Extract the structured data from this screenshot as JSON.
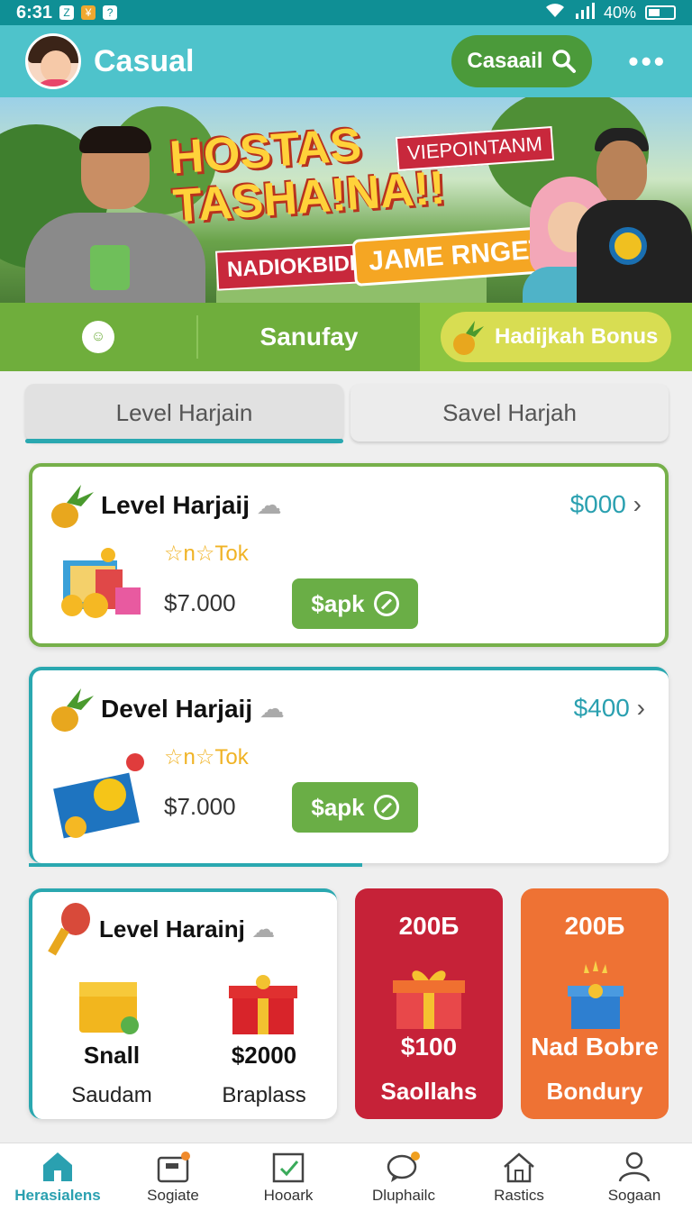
{
  "status_bar": {
    "time": "6:31",
    "battery": "40%"
  },
  "header": {
    "title": "Casual",
    "search_label": "Casaail",
    "more": "•••"
  },
  "banner": {
    "headline_line1": "HOSTAS",
    "headline_line2": "TASHA!NA!!",
    "tag": "VIEPOINTANM",
    "pill_red": "NADIOKBIDM",
    "pill_yellow": "JAME RNGET"
  },
  "greenbar": {
    "tab_label": "Sanufay",
    "bonus_label": "Hadijkah Bonus"
  },
  "tabs": [
    {
      "label": "Level Harjain"
    },
    {
      "label": "Savel Harjah"
    }
  ],
  "cards": [
    {
      "title": "Level Harjaij",
      "price": "$000",
      "stars": "☆n☆Tok",
      "amount": "$7.000",
      "button": "$apk"
    },
    {
      "title": "Devel Harjaij",
      "price": "$400",
      "stars": "☆n☆Tok",
      "amount": "$7.000",
      "button": "$apk"
    }
  ],
  "small_card": {
    "title": "Level Harainj",
    "items": [
      {
        "value": "Snall",
        "label": "Saudam"
      },
      {
        "value": "$2000",
        "label": "Braplass"
      }
    ]
  },
  "promos": [
    {
      "amount": "200Б",
      "line1": "$100",
      "line2": "Saollahs",
      "color": "#c62238"
    },
    {
      "amount": "200Б",
      "line1": "Nad Bobre",
      "line2": "Bondury",
      "color": "#ee7234"
    }
  ],
  "nav": [
    {
      "label": "Herasialens",
      "icon": "home-icon"
    },
    {
      "label": "Sogiate",
      "icon": "wallet-icon"
    },
    {
      "label": "Hooark",
      "icon": "check-board-icon"
    },
    {
      "label": "Dluphailc",
      "icon": "chat-icon"
    },
    {
      "label": "Rastics",
      "icon": "house-icon"
    },
    {
      "label": "Sogaan",
      "icon": "profile-icon"
    }
  ]
}
